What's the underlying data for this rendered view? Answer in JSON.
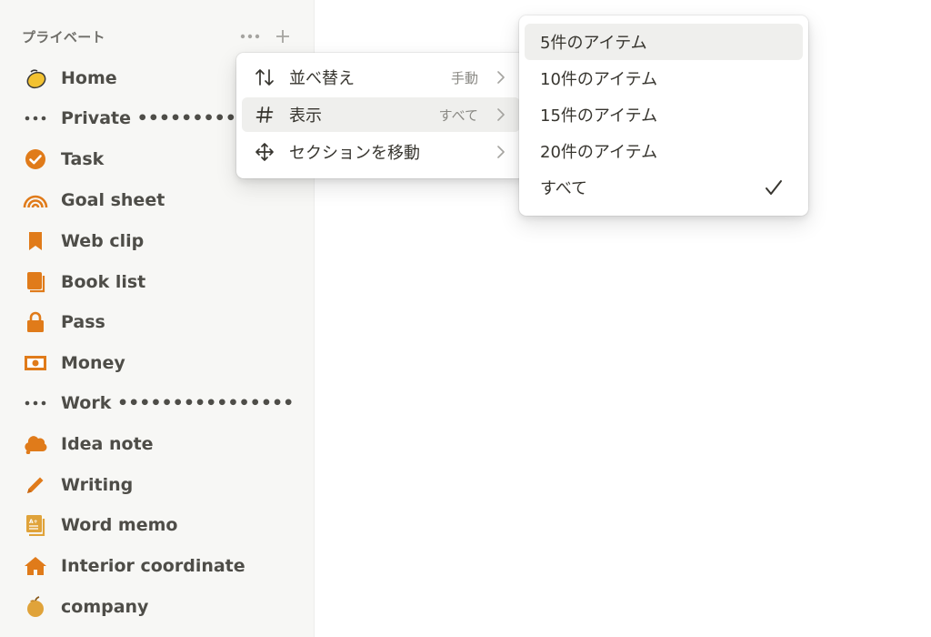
{
  "sidebar": {
    "section_title": "プライベート",
    "items": [
      {
        "label": "Home",
        "icon": "lemon-icon"
      },
      {
        "label": "Private ••••••••••••••",
        "icon": "dots-icon"
      },
      {
        "label": "Task",
        "icon": "check-circle-icon"
      },
      {
        "label": "Goal sheet",
        "icon": "rainbow-icon"
      },
      {
        "label": "Web clip",
        "icon": "bookmark-icon"
      },
      {
        "label": "Book list",
        "icon": "book-icon"
      },
      {
        "label": "Pass",
        "icon": "lock-icon"
      },
      {
        "label": "Money",
        "icon": "banknote-icon"
      },
      {
        "label": "Work ••••••••••••••••",
        "icon": "dots-icon"
      },
      {
        "label": "Idea note",
        "icon": "cloud-icon"
      },
      {
        "label": "Writing",
        "icon": "pencil-icon"
      },
      {
        "label": "Word memo",
        "icon": "note-icon"
      },
      {
        "label": "Interior coordinate",
        "icon": "house-icon"
      },
      {
        "label": "company",
        "icon": "apple-icon"
      }
    ]
  },
  "menu": {
    "items": [
      {
        "label": "並べ替え",
        "value": "手動",
        "icon": "sort-arrows-icon"
      },
      {
        "label": "表示",
        "value": "すべて",
        "icon": "hash-icon"
      },
      {
        "label": "セクションを移動",
        "value": "",
        "icon": "move-icon"
      }
    ]
  },
  "submenu": {
    "items": [
      {
        "label": "5件のアイテム"
      },
      {
        "label": "10件のアイテム"
      },
      {
        "label": "15件のアイテム"
      },
      {
        "label": "20件のアイテム"
      },
      {
        "label": "すべて",
        "checked": true
      }
    ]
  },
  "colors": {
    "accent": "#e07b1a",
    "sidebar_bg": "#f7f7f5",
    "highlight": "#efefed"
  }
}
